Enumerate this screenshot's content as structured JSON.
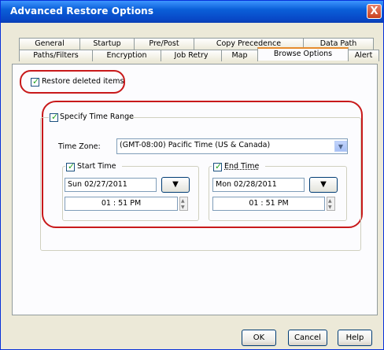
{
  "window": {
    "title": "Advanced Restore Options",
    "close_glyph": "X"
  },
  "tabs_row1": [
    "General",
    "Startup",
    "Pre/Post",
    "Copy Precedence",
    "Data Path"
  ],
  "tabs_row2": [
    "Paths/Filters",
    "Encryption",
    "Job Retry",
    "Map",
    "Browse Options",
    "Alert"
  ],
  "active_tab": "Browse Options",
  "browse": {
    "restore_deleted": {
      "label": "Restore deleted items",
      "checked": true
    },
    "time_range": {
      "label": "Specify Time Range",
      "checked": true
    },
    "time_zone": {
      "label": "Time Zone:",
      "value": "(GMT-08:00) Pacific Time (US & Canada)"
    },
    "start": {
      "label": "Start Time",
      "checked": true,
      "date": "Sun 02/27/2011",
      "time": "01 : 51 PM"
    },
    "end": {
      "label": "End Time",
      "checked": true,
      "date": "Mon 02/28/2011",
      "time": "01 : 51 PM"
    }
  },
  "buttons": {
    "ok": "OK",
    "cancel": "Cancel",
    "help": "Help"
  },
  "colors": {
    "title_bar": "#0a5fd8",
    "highlight_oval": "#c8191a",
    "active_tab_accent": "#e68b2c"
  }
}
